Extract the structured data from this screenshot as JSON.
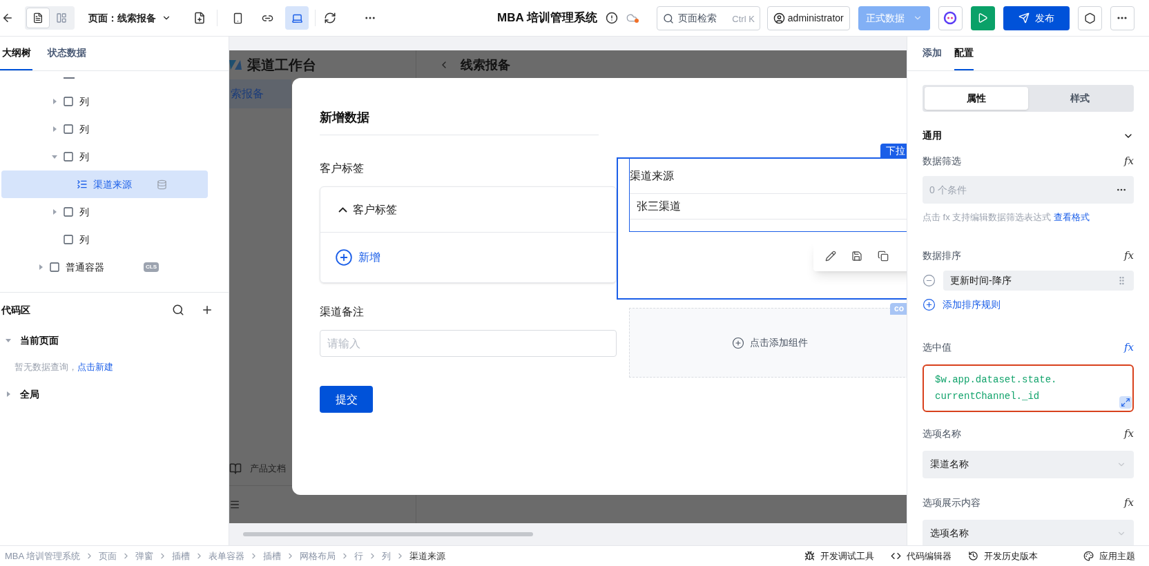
{
  "topbar": {
    "view_modes": [
      {
        "kind": "page",
        "selected": true
      },
      {
        "kind": "layout",
        "selected": false
      }
    ],
    "page_selector": "页面：线索报备",
    "devices": [
      {
        "kind": "mobile",
        "selected": false
      },
      {
        "kind": "miniprogram",
        "selected": false
      },
      {
        "kind": "desktop",
        "selected": true
      }
    ],
    "app_title": "MBA 培训管理系统",
    "search": {
      "placeholder": "页面检索",
      "shortcut": "Ctrl K"
    },
    "user": "administrator",
    "environment": "正式数据",
    "publish": "发布"
  },
  "left_panel": {
    "tabs": [
      {
        "label": "大纲树",
        "selected": true
      },
      {
        "label": "状态数据",
        "selected": false
      }
    ],
    "tree": [
      {
        "kind": "group",
        "children": [
          {
            "kind": "column",
            "label": "列",
            "expanded": false
          },
          {
            "kind": "column",
            "label": "列",
            "expanded": false
          },
          {
            "kind": "column",
            "label": "列",
            "expanded": true,
            "children": [
              {
                "kind": "select",
                "label": "渠道来源",
                "selected": true,
                "data_bound": true
              }
            ]
          },
          {
            "kind": "column",
            "label": "列",
            "expanded": false
          },
          {
            "kind": "column",
            "label": "列"
          }
        ]
      },
      {
        "kind": "container",
        "label": "普通容器",
        "expanded": false,
        "badge": "CLS"
      }
    ],
    "code_area": {
      "title": "代码区",
      "sections": [
        {
          "label": "当前页面",
          "expanded": true,
          "empty_text": "暂无数据查询，",
          "create_link": "点击新建"
        },
        {
          "label": "全局",
          "expanded": false
        }
      ]
    }
  },
  "canvas": {
    "background_page": {
      "logo": "渠道工作台",
      "nav_item": "索报备",
      "header": "线索报备",
      "footer_link": "产品文档"
    },
    "modal": {
      "title": "新增数据",
      "tag_field": {
        "label": "客户标签",
        "group_title": "客户标签",
        "expanded": true,
        "add": "新增"
      },
      "note_field": {
        "label": "渠道备注",
        "placeholder": "请输入"
      },
      "submit": "提交",
      "selected_component": {
        "tag": "下拉",
        "label": "渠道来源",
        "value": "张三渠道"
      },
      "container": {
        "tag": "co",
        "add": "点击添加组件"
      }
    }
  },
  "right_panel": {
    "tabs": [
      {
        "label": "添加",
        "selected": false
      },
      {
        "label": "配置",
        "selected": true
      }
    ],
    "segments": [
      {
        "label": "属性",
        "selected": true
      },
      {
        "label": "样式",
        "selected": false
      }
    ],
    "section": {
      "title": "通用",
      "expanded": true
    },
    "fields": [
      {
        "kind": "filter",
        "label": "数据筛选",
        "fx": "fx",
        "fx_active": false,
        "value": "0 个条件",
        "hint": "点击 fx 支持编辑数据筛选表达式 ",
        "hint_link": "查看格式"
      },
      {
        "kind": "sort",
        "label": "数据排序",
        "fx": "fx",
        "fx_active": false,
        "rule": "更新时间-降序",
        "add": "添加排序规则"
      },
      {
        "kind": "code",
        "label": "选中值",
        "fx": "fx",
        "fx_active": true,
        "lines": [
          "$w.app.dataset.state.",
          "currentChannel._id"
        ]
      },
      {
        "kind": "select",
        "label": "选项名称",
        "fx": "fx",
        "fx_active": false,
        "value": "渠道名称"
      },
      {
        "kind": "select",
        "label": "选项展示内容",
        "fx": "fx",
        "fx_active": false,
        "value": "选项名称"
      }
    ]
  },
  "status_bar": {
    "breadcrumbs": [
      "MBA 培训管理系统",
      "页面",
      "弹窗",
      "插槽",
      "表单容器",
      "插槽",
      "网格布局",
      "行",
      "列",
      "渠道来源"
    ],
    "tools": [
      {
        "kind": "debug",
        "label": "开发调试工具"
      },
      {
        "kind": "code",
        "label": "代码编辑器"
      },
      {
        "kind": "history",
        "label": "开发历史版本"
      },
      {
        "kind": "theme",
        "label": "应用主题"
      }
    ]
  }
}
